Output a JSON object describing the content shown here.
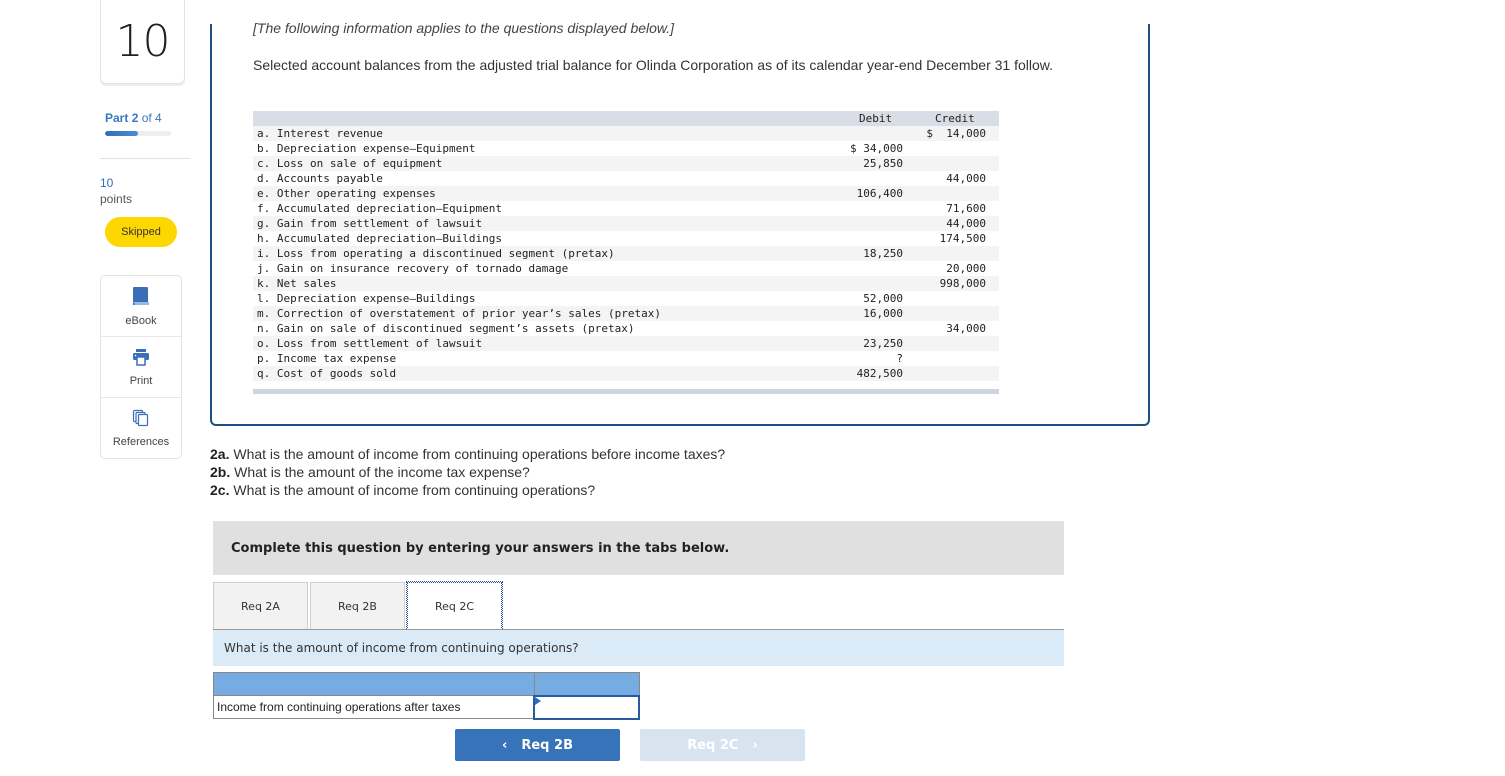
{
  "sidebar": {
    "question_number": "10",
    "part_label": "Part",
    "part_current": "2",
    "part_of": "of 4",
    "part_progress": 0.5,
    "points_value": "10",
    "points_label": "points",
    "status_badge": "Skipped",
    "tools": [
      {
        "label": "eBook",
        "icon": "book-icon"
      },
      {
        "label": "Print",
        "icon": "printer-icon"
      },
      {
        "label": "References",
        "icon": "references-icon"
      }
    ]
  },
  "info": {
    "intro": "[The following information applies to the questions displayed below.]",
    "description": "Selected account balances from the adjusted trial balance for Olinda Corporation as of its calendar year-end December 31 follow."
  },
  "trial_balance": {
    "headers": {
      "debit": "Debit",
      "credit": "Credit"
    },
    "rows": [
      {
        "account": "a. Interest revenue",
        "debit": "",
        "credit": "$  14,000"
      },
      {
        "account": "b. Depreciation expense—Equipment",
        "debit": "$ 34,000",
        "credit": ""
      },
      {
        "account": "c. Loss on sale of equipment",
        "debit": "25,850",
        "credit": ""
      },
      {
        "account": "d. Accounts payable",
        "debit": "",
        "credit": "44,000"
      },
      {
        "account": "e. Other operating expenses",
        "debit": "106,400",
        "credit": ""
      },
      {
        "account": "f. Accumulated depreciation—Equipment",
        "debit": "",
        "credit": "71,600"
      },
      {
        "account": "g. Gain from settlement of lawsuit",
        "debit": "",
        "credit": "44,000"
      },
      {
        "account": "h. Accumulated depreciation—Buildings",
        "debit": "",
        "credit": "174,500"
      },
      {
        "account": "i. Loss from operating a discontinued segment (pretax)",
        "debit": "18,250",
        "credit": ""
      },
      {
        "account": "j. Gain on insurance recovery of tornado damage",
        "debit": "",
        "credit": "20,000"
      },
      {
        "account": "k. Net sales",
        "debit": "",
        "credit": "998,000"
      },
      {
        "account": "l. Depreciation expense—Buildings",
        "debit": "52,000",
        "credit": ""
      },
      {
        "account": "m. Correction of overstatement of prior year’s sales (pretax)",
        "debit": "16,000",
        "credit": ""
      },
      {
        "account": "n. Gain on sale of discontinued segment’s assets (pretax)",
        "debit": "",
        "credit": "34,000"
      },
      {
        "account": "o. Loss from settlement of lawsuit",
        "debit": "23,250",
        "credit": ""
      },
      {
        "account": "p. Income tax expense",
        "debit": "?",
        "credit": ""
      },
      {
        "account": "q. Cost of goods sold",
        "debit": "482,500",
        "credit": ""
      }
    ]
  },
  "questions": [
    {
      "label": "2a.",
      "text": " What is the amount of income from continuing operations before income taxes?"
    },
    {
      "label": "2b.",
      "text": " What is the amount of the income tax expense?"
    },
    {
      "label": "2c.",
      "text": " What is the amount of income from continuing operations?"
    }
  ],
  "instructions": "Complete this question by entering your answers in the tabs below.",
  "tabs": [
    {
      "label": "Req 2A",
      "active": false
    },
    {
      "label": "Req 2B",
      "active": false
    },
    {
      "label": "Req 2C",
      "active": true
    }
  ],
  "active_question": "What is the amount of income from continuing operations?",
  "answer_table": {
    "row_label": "Income from continuing operations after taxes",
    "value": ""
  },
  "navigation": {
    "prev_label": "Req 2B",
    "next_label": "Req 2C"
  },
  "colors": {
    "accent": "#3673b8",
    "badge": "#ffd700",
    "table_header": "#77ace2",
    "question_bar": "#daeaf7"
  }
}
